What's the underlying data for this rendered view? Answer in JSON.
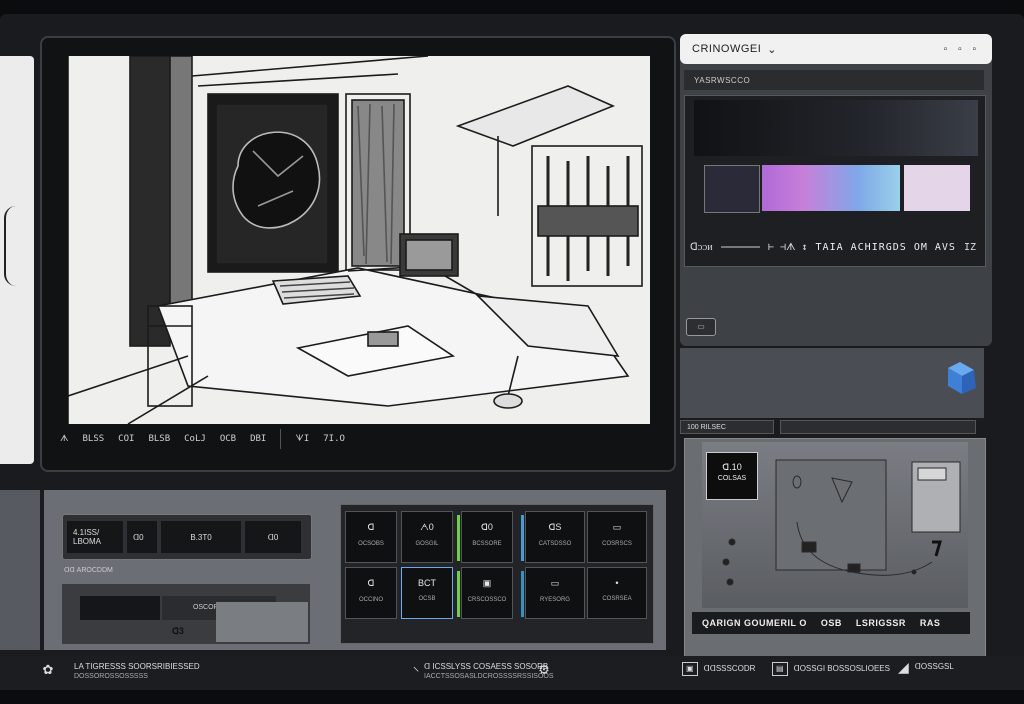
{
  "window": {
    "title": "CRINOWGEI",
    "title_caret": "⌄",
    "window_controls": "▫ ▫ ▫"
  },
  "canvas": {
    "status": [
      "ᗑ",
      "BLSS",
      "COI",
      "BLSB",
      "CoLJ",
      "OCB",
      "DBI"
    ],
    "status_right": [
      "ᗐI",
      "7I.O"
    ]
  },
  "right_panel": {
    "subhead": "YASRWSCCO",
    "swatches": [
      "#2a2a38",
      "gradient",
      "#e4d5e8"
    ],
    "control_row": {
      "left": "ᗡᴐᴐᴎ",
      "markers": "⊢ ⊣ᗑ ↕",
      "label": "TAIA ACHIRGDS OM AVS",
      "value": "IZ"
    },
    "small_button": "▭",
    "tabs": [
      "100 RILSEC",
      ""
    ],
    "badge": {
      "line1": "ᗡ.10",
      "line2": "COLSAS"
    },
    "bottom_bar": [
      "QARIGN GOUMERIL O",
      "OSB",
      "LSRIGSSR",
      "RAS"
    ]
  },
  "left_widgets": {
    "widget_a": [
      "4.1ISS/\nLBOMA",
      "ᗡ0",
      "B.3T0",
      "ᗡ0"
    ],
    "addr": "ᗡᗡ AROCDDM",
    "widget_b": {
      "bar2": "OSCOR ORSPE",
      "txt": "ᗡ3"
    }
  },
  "grid": {
    "tiles": [
      {
        "t": "ᗡ",
        "s": "OCSOBS"
      },
      {
        "t": "ᗅ0",
        "s": "GOSGIL"
      },
      {
        "t": "ᗡ0",
        "s": "BCSSORE"
      },
      {
        "t": "ᗡS",
        "s": "CATSDSSO"
      },
      {
        "t": "▭",
        "s": "COSRSCS"
      },
      {
        "t": "ᗡ",
        "s": "OCCINO"
      },
      {
        "t": "BCT",
        "s": "OCSB"
      },
      {
        "t": "▣",
        "s": "CRSCOSSCO"
      },
      {
        "t": "▭",
        "s": "RYESORG"
      },
      {
        "t": "•",
        "s": "COSRSEA"
      }
    ],
    "accents": [
      "#6fcf4a",
      "#4a9ad9",
      "#6fcf4a",
      "#3a8fc4"
    ]
  },
  "footer": {
    "left_text_1": "LA TIGRESSS SOORSRIBIESSED",
    "left_text_2": "DOSSOROSSOSSSSS",
    "mid_text_1": "ᗡ ICSSLYSS COSAESS SOSORB",
    "mid_text_2": "IACCTSSOSASLDCROSSSSRSSISOOS",
    "right_items": [
      "ᗡᗡSSSCODR",
      "ᗡOSSGI BOSSOSLIOEES",
      "ᗡOSSGSL"
    ]
  }
}
